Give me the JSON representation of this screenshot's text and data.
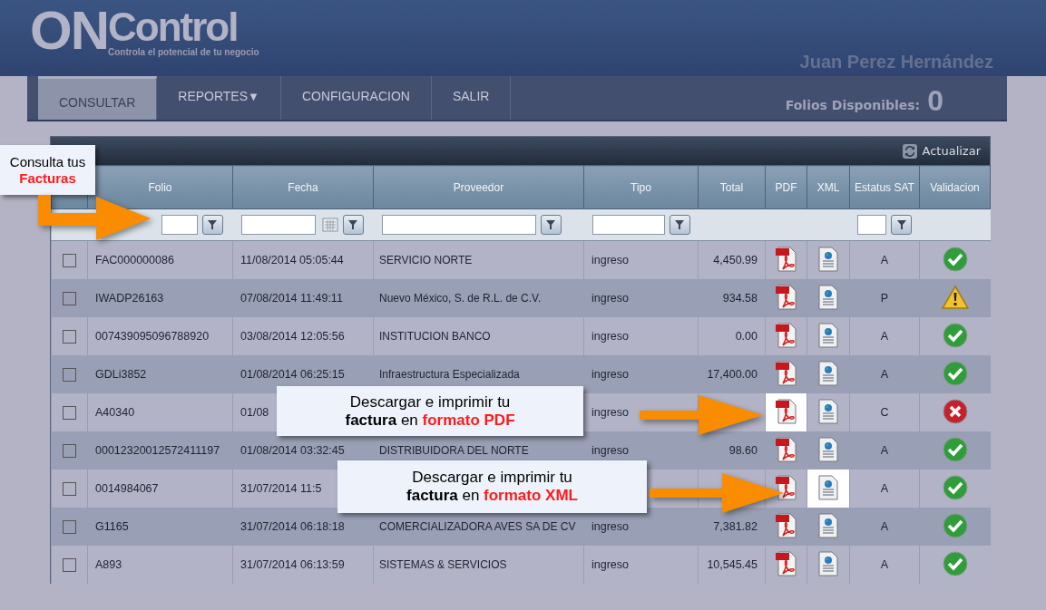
{
  "logo": {
    "prefix": "ON",
    "name": "Control",
    "tagline": "Controla el potencial de tu negocio"
  },
  "user": "Juan Perez Hernández",
  "nav": [
    {
      "label": "CONSULTAR",
      "selected": true,
      "caret": false
    },
    {
      "label": "REPORTES",
      "selected": false,
      "caret": true
    },
    {
      "label": "CONFIGURACION",
      "selected": false,
      "caret": false
    },
    {
      "label": "SALIR",
      "selected": false,
      "caret": false
    }
  ],
  "nav_caret": "▼",
  "folios": {
    "label": "Folios Disponibles:",
    "value": "0"
  },
  "toolbar": {
    "refresh": "Actualizar"
  },
  "columns": [
    "Folio",
    "Fecha",
    "Proveedor",
    "Tipo",
    "Total",
    "PDF",
    "XML",
    "Estatus SAT",
    "Validacion"
  ],
  "rows": [
    {
      "checked": false,
      "folio": "FAC000000086",
      "fecha": "11/08/2014 05:05:44",
      "proveedor": "SERVICIO NORTE",
      "tipo": "ingreso",
      "total": "4,450.99",
      "estatus": "A",
      "validation": {
        "kind": "ok"
      },
      "pdf_highlighted": false,
      "xml_highlighted": false
    },
    {
      "checked": false,
      "folio": "IWADP26163",
      "fecha": "07/08/2014 11:49:11",
      "proveedor": "Nuevo México, S. de R.L. de C.V.",
      "tipo": "ingreso",
      "total": "934.58",
      "estatus": "P",
      "validation": {
        "kind": "warning"
      },
      "pdf_highlighted": false,
      "xml_highlighted": false
    },
    {
      "checked": false,
      "folio": "007439095096788920",
      "fecha": "03/08/2014 12:05:56",
      "proveedor": "INSTITUCION BANCO",
      "tipo": "ingreso",
      "total": "0.00",
      "estatus": "A",
      "validation": {
        "kind": "ok"
      },
      "pdf_highlighted": false,
      "xml_highlighted": false
    },
    {
      "checked": false,
      "folio": "GDLi3852",
      "fecha": "01/08/2014 06:25:15",
      "proveedor": "Infraestructura Especializada",
      "tipo": "ingreso",
      "total": "17,400.00",
      "estatus": "A",
      "validation": {
        "kind": "ok"
      },
      "pdf_highlighted": false,
      "xml_highlighted": false
    },
    {
      "checked": false,
      "folio": "A40340",
      "fecha": "01/08",
      "tipo": "ingreso",
      "estatus": "C",
      "validation": {
        "kind": "error"
      },
      "pdf_highlighted": true,
      "xml_highlighted": false
    },
    {
      "checked": false,
      "folio": "00012320012572411197",
      "fecha": "01/08/2014 03:32:45",
      "proveedor": "DISTRIBUIDORA DEL NORTE",
      "tipo": "ingreso",
      "total": "98.60",
      "estatus": "A",
      "validation": {
        "kind": "ok"
      },
      "pdf_highlighted": false,
      "xml_highlighted": false
    },
    {
      "checked": false,
      "folio": "0014984067",
      "fecha": "31/07/2014 11:5",
      "estatus": "A",
      "validation": {
        "kind": "ok"
      },
      "pdf_highlighted": false,
      "xml_highlighted": true
    },
    {
      "checked": false,
      "folio": "G1165",
      "fecha": "31/07/2014 06:18:18",
      "proveedor": "COMERCIALIZADORA AVES SA DE CV",
      "tipo": "ingreso",
      "total": "7,381.82",
      "estatus": "A",
      "validation": {
        "kind": "ok"
      },
      "pdf_highlighted": false,
      "xml_highlighted": false
    },
    {
      "checked": false,
      "folio": "A893",
      "fecha": "31/07/2014 06:13:59",
      "proveedor": "SISTEMAS & SERVICIOS",
      "tipo": "ingreso",
      "total": "10,545.45",
      "estatus": "A",
      "validation": {
        "kind": "ok"
      },
      "pdf_highlighted": false,
      "xml_highlighted": false
    }
  ],
  "callouts": [
    {
      "text": "Consulta tus **Facturas**"
    },
    {
      "text": "Descargar e imprimir tu **factura** en **formato PDF**"
    },
    {
      "text": "Descargar e imprimir tu **factura** en **formato XML**"
    }
  ]
}
